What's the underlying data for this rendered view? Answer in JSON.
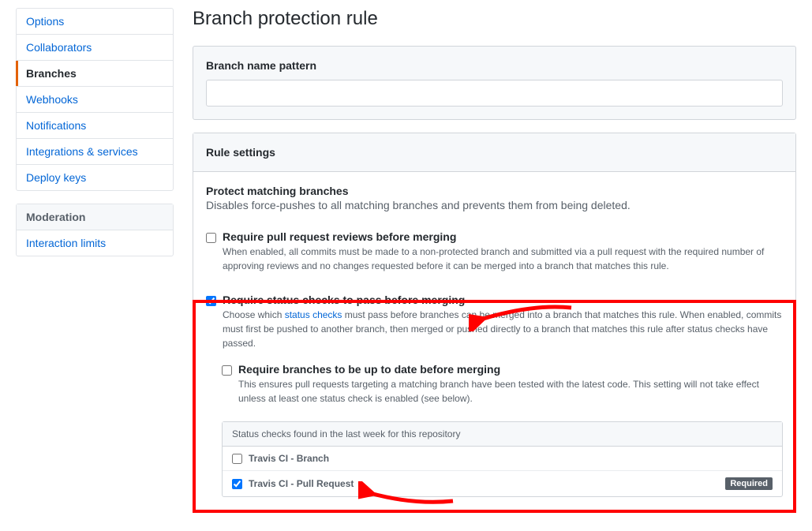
{
  "sidebar": {
    "items": [
      {
        "label": "Options"
      },
      {
        "label": "Collaborators"
      },
      {
        "label": "Branches"
      },
      {
        "label": "Webhooks"
      },
      {
        "label": "Notifications"
      },
      {
        "label": "Integrations & services"
      },
      {
        "label": "Deploy keys"
      }
    ],
    "moderation_heading": "Moderation",
    "moderation_items": [
      {
        "label": "Interaction limits"
      }
    ]
  },
  "page": {
    "title": "Branch protection rule"
  },
  "pattern": {
    "label": "Branch name pattern",
    "value": ""
  },
  "rule_settings": {
    "heading": "Rule settings",
    "protect_title": "Protect matching branches",
    "protect_desc": "Disables force-pushes to all matching branches and prevents them from being deleted.",
    "require_pr_label": "Require pull request reviews before merging",
    "require_pr_desc": "When enabled, all commits must be made to a non-protected branch and submitted via a pull request with the required number of approving reviews and no changes requested before it can be merged into a branch that matches this rule.",
    "require_status_label": "Require status checks to pass before merging",
    "require_status_desc_pre": "Choose which ",
    "require_status_link": "status checks",
    "require_status_desc_post": " must pass before branches can be merged into a branch that matches this rule. When enabled, commits must first be pushed to another branch, then merged or pushed directly to a branch that matches this rule after status checks have passed.",
    "require_uptodate_label": "Require branches to be up to date before merging",
    "require_uptodate_desc": "This ensures pull requests targeting a matching branch have been tested with the latest code. This setting will not take effect unless at least one status check is enabled (see below).",
    "status_list_heading": "Status checks found in the last week for this repository",
    "status_checks": [
      {
        "name": "Travis CI - Branch",
        "checked": false,
        "required": false
      },
      {
        "name": "Travis CI - Pull Request",
        "checked": true,
        "required": true
      }
    ],
    "required_badge": "Required"
  }
}
